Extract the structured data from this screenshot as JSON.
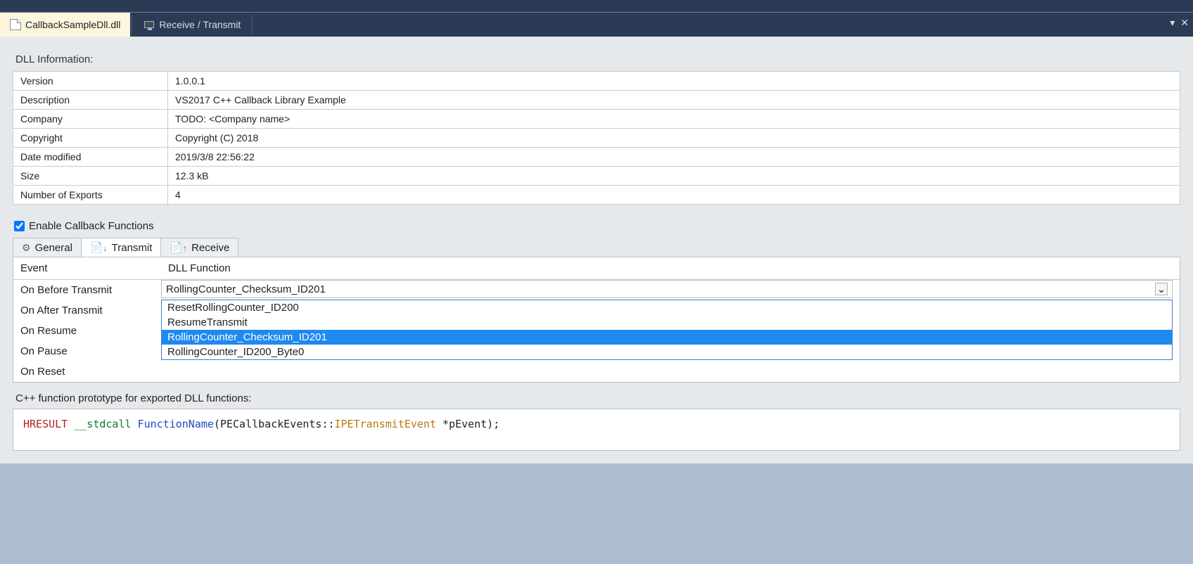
{
  "topTabs": {
    "active": {
      "label": "CallbackSampleDll.dll"
    },
    "other": {
      "label": "Receive / Transmit"
    }
  },
  "dllInfo": {
    "title": "DLL Information:",
    "rows": {
      "version": {
        "k": "Version",
        "v": "1.0.0.1"
      },
      "description": {
        "k": "Description",
        "v": "VS2017 C++ Callback Library Example"
      },
      "company": {
        "k": "Company",
        "v": "TODO: <Company name>"
      },
      "copyright": {
        "k": "Copyright",
        "v": "Copyright (C) 2018"
      },
      "dateModified": {
        "k": "Date modified",
        "v": "2019/3/8 22:56:22"
      },
      "size": {
        "k": "Size",
        "v": "12.3 kB"
      },
      "numExports": {
        "k": "Number of Exports",
        "v": "4"
      }
    }
  },
  "enableCb": {
    "label": "Enable Callback Functions",
    "checked": true
  },
  "innerTabs": {
    "general": "General",
    "transmit": "Transmit",
    "receive": "Receive"
  },
  "eventGrid": {
    "hdr": {
      "event": "Event",
      "func": "DLL Function"
    },
    "rows": {
      "beforeTx": "On Before Transmit",
      "afterTx": "On After Transmit",
      "resume": "On Resume",
      "pause": "On Pause",
      "reset": "On Reset"
    },
    "beforeTxValue": "RollingCounter_Checksum_ID201",
    "options": {
      "o0": "ResetRollingCounter_ID200",
      "o1": "ResumeTransmit",
      "o2": "RollingCounter_Checksum_ID201",
      "o3": "RollingCounter_ID200_Byte0"
    }
  },
  "proto": {
    "label": "C++ function prototype for exported DLL functions:",
    "code": {
      "hresult": "HRESULT",
      "stdcall": "__stdcall",
      "fname": "FunctionName",
      "rest1": "(PECallbackEvents::",
      "cls": "IPETransmitEvent",
      "rest2": " *pEvent);"
    }
  }
}
